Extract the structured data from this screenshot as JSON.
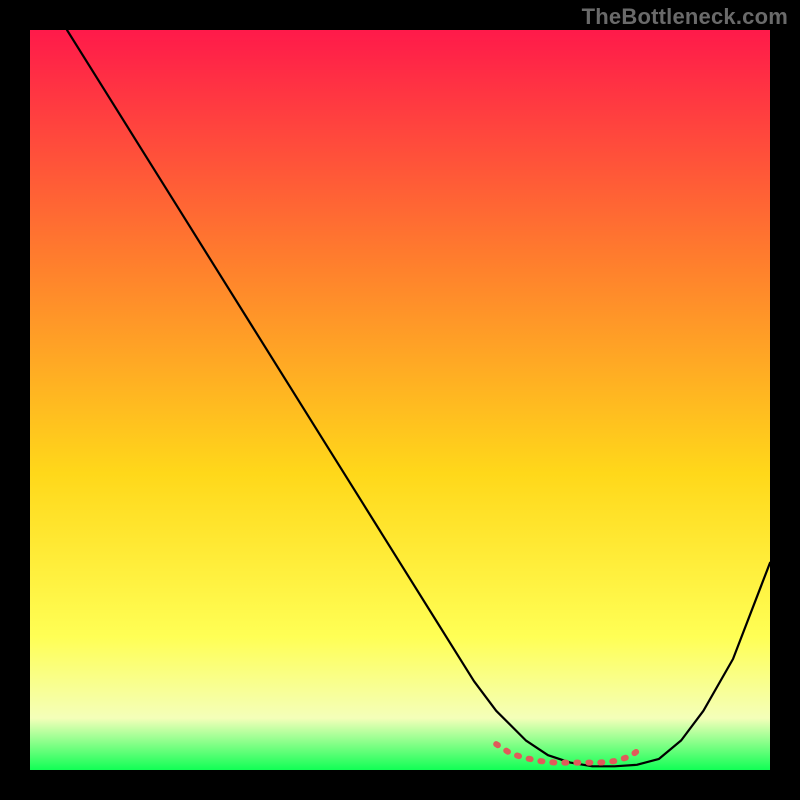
{
  "watermark": "TheBottleneck.com",
  "colors": {
    "grad_top": "#ff1a4a",
    "grad_mid1": "#ff7a2e",
    "grad_mid2": "#ffd81a",
    "grad_mid3": "#ffff55",
    "grad_mid4": "#f4ffb9",
    "grad_bottom": "#11ff55",
    "curve": "#000000",
    "dots": "#e05a5a"
  },
  "chart_data": {
    "type": "line",
    "title": "",
    "xlabel": "",
    "ylabel": "",
    "xlim": [
      0,
      100
    ],
    "ylim": [
      0,
      100
    ],
    "series": [
      {
        "name": "bottleneck-curve",
        "x": [
          5,
          10,
          15,
          20,
          25,
          30,
          35,
          40,
          45,
          50,
          55,
          60,
          63,
          67,
          70,
          73,
          76,
          79,
          82,
          85,
          88,
          91,
          95,
          100
        ],
        "y": [
          100,
          92,
          84,
          76,
          68,
          60,
          52,
          44,
          36,
          28,
          20,
          12,
          8,
          4,
          2,
          1,
          0.5,
          0.5,
          0.7,
          1.5,
          4,
          8,
          15,
          28
        ]
      }
    ],
    "optimal_region": {
      "name": "optimal-dotted",
      "x": [
        63,
        65,
        67,
        69,
        71,
        73,
        75,
        77,
        79,
        81,
        83
      ],
      "y": [
        3.5,
        2.2,
        1.6,
        1.2,
        1.0,
        1.0,
        1.0,
        1.0,
        1.2,
        1.8,
        3.2
      ]
    }
  }
}
